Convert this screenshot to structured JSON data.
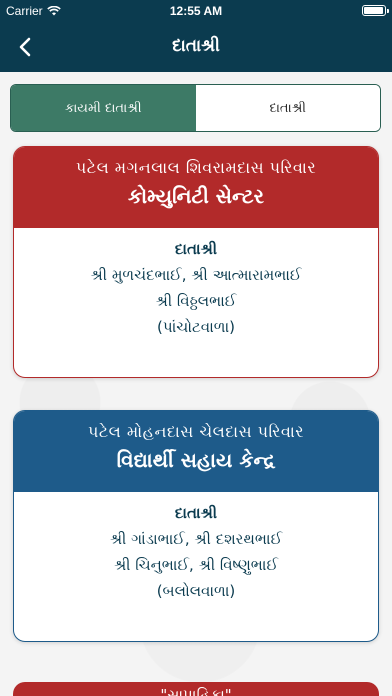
{
  "status": {
    "carrier": "Carrier",
    "time": "12:55 AM"
  },
  "nav": {
    "title": "દાતાશ્રી"
  },
  "tabs": [
    {
      "label": "કાયમી દાતાશ્રી",
      "active": true
    },
    {
      "label": "દાતાશ્રી",
      "active": false
    }
  ],
  "cards": [
    {
      "family": "પટેલ મગનલાલ શિવરામદાસ પરિવાર",
      "name": "કોમ્યુનિટી સેન્ટર",
      "label": "દાતાશ્રી",
      "lines": [
        "શ્રી મુળચંદભાઈ, શ્રી આત્મારામભાઈ",
        "શ્રી વિઠ્ઠલભાઈ",
        "(પાંચોટવાળા)"
      ],
      "color": "#b22a2a"
    },
    {
      "family": "પટેલ મોહનદાસ ચેલદાસ પરિવાર",
      "name": "વિદ્યાર્થી સહાય કેન્દ્ર",
      "label": "દાતાશ્રી",
      "lines": [
        "શ્રી ગાંડાભાઈ, શ્રી દશરથભાઈ",
        "શ્રી ચિનુભાઈ, શ્રી વિષ્ણુભાઈ",
        "(બલોલવાળા)"
      ],
      "color": "#1e5b8a"
    }
  ],
  "partial_card": {
    "text": "\"સાપાહિકા\""
  },
  "colors": {
    "nav": "#0b3b4f",
    "accent": "#3d7a66"
  }
}
